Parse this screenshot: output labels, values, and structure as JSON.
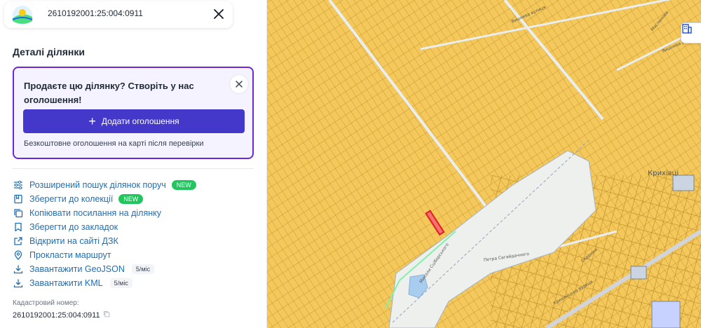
{
  "header": {
    "search_value": "2610192001:25:004:0911"
  },
  "details": {
    "title": "Деталі ділянки"
  },
  "promo": {
    "title": "Продаєте цю ділянку? Створіть у нас оголошення!",
    "button_label": "Додати оголошення",
    "note": "Безкоштовне оголошення на карті після перевірки"
  },
  "actions": [
    {
      "label": "Розширений пошук ділянок поруч",
      "icon": "sliders-icon",
      "badge": "NEW"
    },
    {
      "label": "Зберегти до колекції",
      "icon": "collection-icon",
      "badge": "NEW"
    },
    {
      "label": "Копіювати посилання на ділянку",
      "icon": "copy-icon",
      "badge": ""
    },
    {
      "label": "Зберегти до закладок",
      "icon": "bookmark-icon",
      "badge": ""
    },
    {
      "label": "Відкрити на сайті ДЗК",
      "icon": "external-link-icon",
      "badge": ""
    },
    {
      "label": "Прокласти маршрут",
      "icon": "location-pin-icon",
      "badge": ""
    },
    {
      "label": "Завантажити GeoJSON",
      "icon": "download-icon",
      "limit": "5/міс"
    },
    {
      "label": "Завантажити KML",
      "icon": "download-icon",
      "limit": "5/міс"
    }
  ],
  "cadastral": {
    "label": "Кадастровий номер:",
    "value": "2610192001:25:004:0911"
  },
  "map": {
    "place_label": "Крихівці",
    "street_labels": [
      "Вишнева вулиця",
      "Вишнева вулиця",
      "Миколи Сціборського",
      "Сердюка",
      "Крихівецька вулиця",
      "Маслинова",
      "Петра Сагайдачного"
    ],
    "colors": {
      "parcel_fill": "#f4c85a",
      "parcel_line": "#b98a2a",
      "selected_parcel": "#e11d24",
      "open_area": "#eef0ee",
      "water": "#a8cdef"
    }
  },
  "colors": {
    "accent": "#4338ca",
    "promo_border": "#6d28d9",
    "link": "#1d6fb8",
    "badge_new": "#22c55e"
  }
}
